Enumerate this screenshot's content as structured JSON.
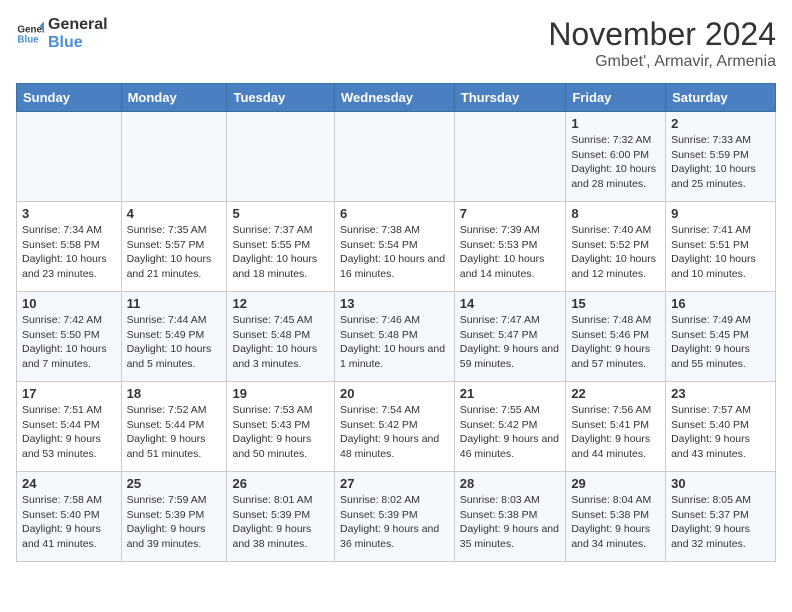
{
  "header": {
    "logo_line1": "General",
    "logo_line2": "Blue",
    "month": "November 2024",
    "location": "Gmbet', Armavir, Armenia"
  },
  "days_of_week": [
    "Sunday",
    "Monday",
    "Tuesday",
    "Wednesday",
    "Thursday",
    "Friday",
    "Saturday"
  ],
  "weeks": [
    [
      {
        "day": "",
        "info": ""
      },
      {
        "day": "",
        "info": ""
      },
      {
        "day": "",
        "info": ""
      },
      {
        "day": "",
        "info": ""
      },
      {
        "day": "",
        "info": ""
      },
      {
        "day": "1",
        "info": "Sunrise: 7:32 AM\nSunset: 6:00 PM\nDaylight: 10 hours and 28 minutes."
      },
      {
        "day": "2",
        "info": "Sunrise: 7:33 AM\nSunset: 5:59 PM\nDaylight: 10 hours and 25 minutes."
      }
    ],
    [
      {
        "day": "3",
        "info": "Sunrise: 7:34 AM\nSunset: 5:58 PM\nDaylight: 10 hours and 23 minutes."
      },
      {
        "day": "4",
        "info": "Sunrise: 7:35 AM\nSunset: 5:57 PM\nDaylight: 10 hours and 21 minutes."
      },
      {
        "day": "5",
        "info": "Sunrise: 7:37 AM\nSunset: 5:55 PM\nDaylight: 10 hours and 18 minutes."
      },
      {
        "day": "6",
        "info": "Sunrise: 7:38 AM\nSunset: 5:54 PM\nDaylight: 10 hours and 16 minutes."
      },
      {
        "day": "7",
        "info": "Sunrise: 7:39 AM\nSunset: 5:53 PM\nDaylight: 10 hours and 14 minutes."
      },
      {
        "day": "8",
        "info": "Sunrise: 7:40 AM\nSunset: 5:52 PM\nDaylight: 10 hours and 12 minutes."
      },
      {
        "day": "9",
        "info": "Sunrise: 7:41 AM\nSunset: 5:51 PM\nDaylight: 10 hours and 10 minutes."
      }
    ],
    [
      {
        "day": "10",
        "info": "Sunrise: 7:42 AM\nSunset: 5:50 PM\nDaylight: 10 hours and 7 minutes."
      },
      {
        "day": "11",
        "info": "Sunrise: 7:44 AM\nSunset: 5:49 PM\nDaylight: 10 hours and 5 minutes."
      },
      {
        "day": "12",
        "info": "Sunrise: 7:45 AM\nSunset: 5:48 PM\nDaylight: 10 hours and 3 minutes."
      },
      {
        "day": "13",
        "info": "Sunrise: 7:46 AM\nSunset: 5:48 PM\nDaylight: 10 hours and 1 minute."
      },
      {
        "day": "14",
        "info": "Sunrise: 7:47 AM\nSunset: 5:47 PM\nDaylight: 9 hours and 59 minutes."
      },
      {
        "day": "15",
        "info": "Sunrise: 7:48 AM\nSunset: 5:46 PM\nDaylight: 9 hours and 57 minutes."
      },
      {
        "day": "16",
        "info": "Sunrise: 7:49 AM\nSunset: 5:45 PM\nDaylight: 9 hours and 55 minutes."
      }
    ],
    [
      {
        "day": "17",
        "info": "Sunrise: 7:51 AM\nSunset: 5:44 PM\nDaylight: 9 hours and 53 minutes."
      },
      {
        "day": "18",
        "info": "Sunrise: 7:52 AM\nSunset: 5:44 PM\nDaylight: 9 hours and 51 minutes."
      },
      {
        "day": "19",
        "info": "Sunrise: 7:53 AM\nSunset: 5:43 PM\nDaylight: 9 hours and 50 minutes."
      },
      {
        "day": "20",
        "info": "Sunrise: 7:54 AM\nSunset: 5:42 PM\nDaylight: 9 hours and 48 minutes."
      },
      {
        "day": "21",
        "info": "Sunrise: 7:55 AM\nSunset: 5:42 PM\nDaylight: 9 hours and 46 minutes."
      },
      {
        "day": "22",
        "info": "Sunrise: 7:56 AM\nSunset: 5:41 PM\nDaylight: 9 hours and 44 minutes."
      },
      {
        "day": "23",
        "info": "Sunrise: 7:57 AM\nSunset: 5:40 PM\nDaylight: 9 hours and 43 minutes."
      }
    ],
    [
      {
        "day": "24",
        "info": "Sunrise: 7:58 AM\nSunset: 5:40 PM\nDaylight: 9 hours and 41 minutes."
      },
      {
        "day": "25",
        "info": "Sunrise: 7:59 AM\nSunset: 5:39 PM\nDaylight: 9 hours and 39 minutes."
      },
      {
        "day": "26",
        "info": "Sunrise: 8:01 AM\nSunset: 5:39 PM\nDaylight: 9 hours and 38 minutes."
      },
      {
        "day": "27",
        "info": "Sunrise: 8:02 AM\nSunset: 5:39 PM\nDaylight: 9 hours and 36 minutes."
      },
      {
        "day": "28",
        "info": "Sunrise: 8:03 AM\nSunset: 5:38 PM\nDaylight: 9 hours and 35 minutes."
      },
      {
        "day": "29",
        "info": "Sunrise: 8:04 AM\nSunset: 5:38 PM\nDaylight: 9 hours and 34 minutes."
      },
      {
        "day": "30",
        "info": "Sunrise: 8:05 AM\nSunset: 5:37 PM\nDaylight: 9 hours and 32 minutes."
      }
    ]
  ]
}
